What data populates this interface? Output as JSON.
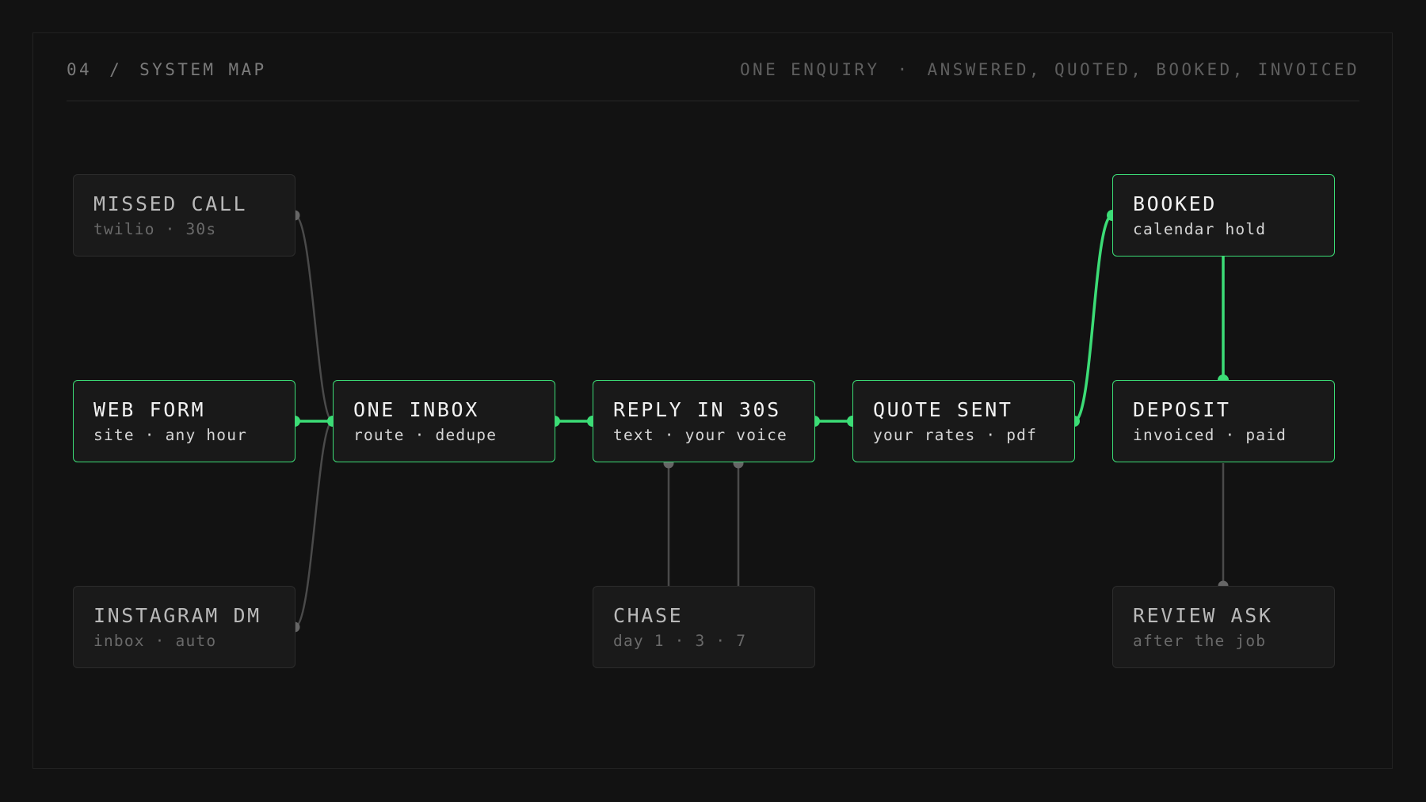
{
  "header": {
    "section_number": "04",
    "separator": "/",
    "section_title": "SYSTEM MAP",
    "tagline_lead": "ONE ENQUIRY",
    "tagline_dot": "·",
    "tagline_steps": "ANSWERED, QUOTED, BOOKED, INVOICED"
  },
  "colors": {
    "background": "#121212",
    "accent_green": "#3cdc76",
    "inactive_wire": "#4a4a4a",
    "inactive_port": "#666666"
  },
  "nodes": {
    "missed_call": {
      "title": "MISSED CALL",
      "subtitle": "twilio · 30s",
      "state": "inactive"
    },
    "web_form": {
      "title": "WEB FORM",
      "subtitle": "site · any hour",
      "state": "active"
    },
    "instagram_dm": {
      "title": "INSTAGRAM DM",
      "subtitle": "inbox · auto",
      "state": "inactive"
    },
    "one_inbox": {
      "title": "ONE INBOX",
      "subtitle": "route · dedupe",
      "state": "active"
    },
    "reply": {
      "title": "REPLY IN 30S",
      "subtitle": "text · your voice",
      "state": "active"
    },
    "chase": {
      "title": "CHASE",
      "subtitle": "day 1 · 3 · 7",
      "state": "inactive"
    },
    "quote": {
      "title": "QUOTE SENT",
      "subtitle": "your rates · pdf",
      "state": "active"
    },
    "booked": {
      "title": "BOOKED",
      "subtitle": "calendar hold",
      "state": "active"
    },
    "deposit": {
      "title": "DEPOSIT",
      "subtitle": "invoiced · paid",
      "state": "active"
    },
    "review": {
      "title": "REVIEW ASK",
      "subtitle": "after the job",
      "state": "inactive"
    }
  },
  "edges": [
    {
      "from": "missed_call",
      "to": "one_inbox",
      "state": "inactive"
    },
    {
      "from": "instagram_dm",
      "to": "one_inbox",
      "state": "inactive"
    },
    {
      "from": "web_form",
      "to": "one_inbox",
      "state": "active"
    },
    {
      "from": "one_inbox",
      "to": "reply",
      "state": "active"
    },
    {
      "from": "reply",
      "to": "quote",
      "state": "active"
    },
    {
      "from": "reply",
      "to": "chase",
      "state": "inactive"
    },
    {
      "from": "reply",
      "to": "chase",
      "state": "inactive"
    },
    {
      "from": "quote",
      "to": "booked",
      "state": "active"
    },
    {
      "from": "booked",
      "to": "deposit",
      "state": "active"
    },
    {
      "from": "deposit",
      "to": "review",
      "state": "inactive"
    }
  ]
}
